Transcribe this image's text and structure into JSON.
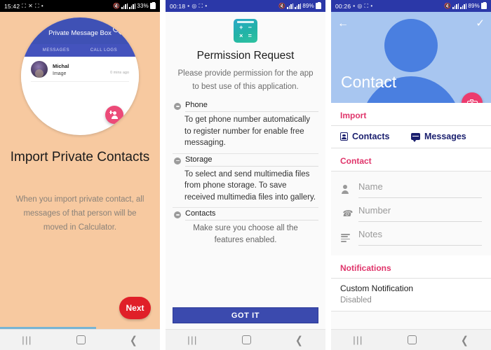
{
  "panels": [
    {
      "status_bar": {
        "time": "15:42",
        "battery": "33%",
        "icons": [
          "dnd-icon",
          "mute-icon",
          "dnd-icon",
          "dot-icon"
        ]
      },
      "widget": {
        "title": "Private Message Box",
        "search_icon": "search-icon",
        "tabs": [
          "MESSAGES",
          "CALL LOGS"
        ],
        "message": {
          "name": "Michal",
          "preview": "Image",
          "time": "0 mins ago"
        },
        "fab_icon": "add-person-icon"
      },
      "heading": "Import Private Contacts",
      "description": "When you import private contact, all messages of that person will be moved in Calculator.",
      "next_label": "Next",
      "progress_percent": 60,
      "nav": {
        "recent": "|||",
        "home": "home-icon",
        "back": "back-icon"
      }
    },
    {
      "status_bar": {
        "time": "00:18",
        "battery": "89%",
        "icons": [
          "video-icon",
          "record-icon",
          "dnd-icon",
          "dot-icon"
        ]
      },
      "app_icon": {
        "name": "calculator-icon",
        "symbols": [
          "+",
          "−",
          "×",
          "="
        ]
      },
      "title": "Permission Request",
      "subtitle": "Please provide permission for the app to best use of this application.",
      "permissions": [
        {
          "name": "Phone",
          "description": "To get phone number automatically to register number for enable free messaging."
        },
        {
          "name": "Storage",
          "description": "To select and send multimedia files from phone storage. To save received multimedia files into gallery."
        },
        {
          "name": "Contacts",
          "description": "Make sure you choose all the features enabled."
        }
      ],
      "button_label": "GOT IT",
      "nav": {
        "recent": "|||",
        "home": "home-icon",
        "back": "back-icon"
      }
    },
    {
      "status_bar": {
        "time": "00:26",
        "battery": "89%",
        "icons": [
          "video-icon",
          "record-icon",
          "dnd-icon",
          "dot-icon"
        ]
      },
      "header": {
        "back_icon": "back-arrow-icon",
        "confirm_icon": "check-icon",
        "title": "Contact",
        "fab_icon": "camera-icon"
      },
      "import_section": {
        "title": "Import",
        "options": [
          {
            "label": "Contacts",
            "icon": "contact-book-icon"
          },
          {
            "label": "Messages",
            "icon": "message-bubble-icon"
          }
        ]
      },
      "contact_section": {
        "title": "Contact",
        "fields": [
          {
            "placeholder": "Name",
            "icon": "person-icon",
            "value": ""
          },
          {
            "placeholder": "Number",
            "icon": "phone-icon",
            "value": ""
          },
          {
            "placeholder": "Notes",
            "icon": "notes-icon",
            "value": ""
          }
        ]
      },
      "notifications_section": {
        "title": "Notifications",
        "item": {
          "label": "Custom Notification",
          "status": "Disabled"
        }
      },
      "nav": {
        "recent": "|||",
        "home": "home-icon",
        "back": "back-icon"
      }
    }
  ],
  "colors": {
    "panel1_bg": "#f7c9a0",
    "widget_header": "#3f51b5",
    "next_button": "#e01f28",
    "fab_pink": "#ec4a78",
    "got_it": "#3b4aae",
    "accent_pink": "#e0356b",
    "navy": "#1a1f6e",
    "header_blue": "#a8c6f0"
  }
}
